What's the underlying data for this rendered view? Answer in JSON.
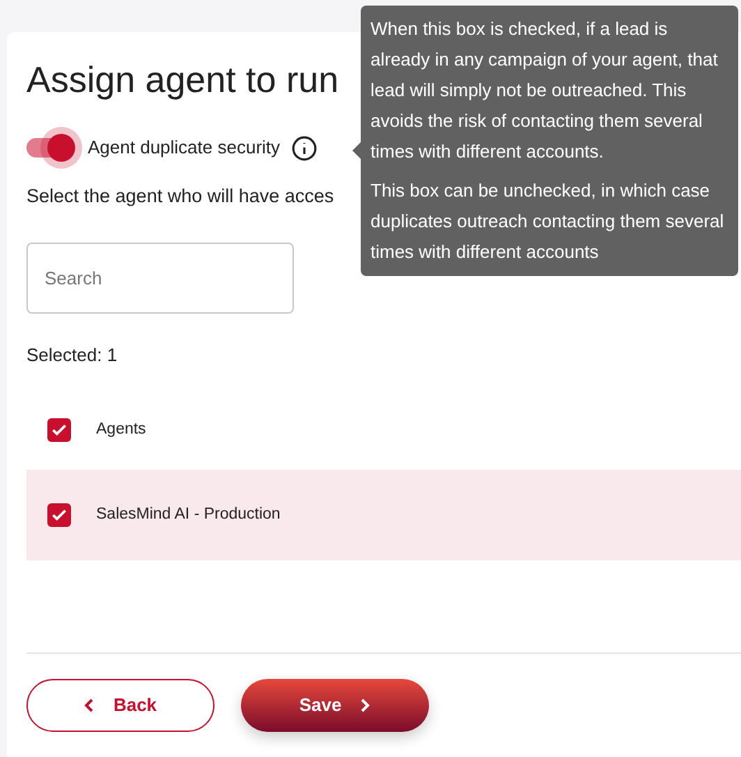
{
  "title": "Assign agent to run",
  "duplicate_toggle": {
    "label": "Agent duplicate security",
    "on": true
  },
  "tooltip": {
    "paragraphs": [
      "When this box is checked, if a lead is already in any campaign of your agent, that lead will simply not be outreached. This avoids the risk of contacting them several times with different accounts.",
      "This box can be unchecked, in which case duplicates outreach contacting them several times with different accounts"
    ]
  },
  "subtitle": "Select the agent who will have acces",
  "search": {
    "placeholder": "Search"
  },
  "selected_count": "Selected: 1",
  "table": {
    "header": {
      "label": "Agents",
      "checked": true
    },
    "rows": [
      {
        "label": "SalesMind AI - Production",
        "checked": true,
        "selected": true
      }
    ]
  },
  "buttons": {
    "back": "Back",
    "save": "Save"
  }
}
